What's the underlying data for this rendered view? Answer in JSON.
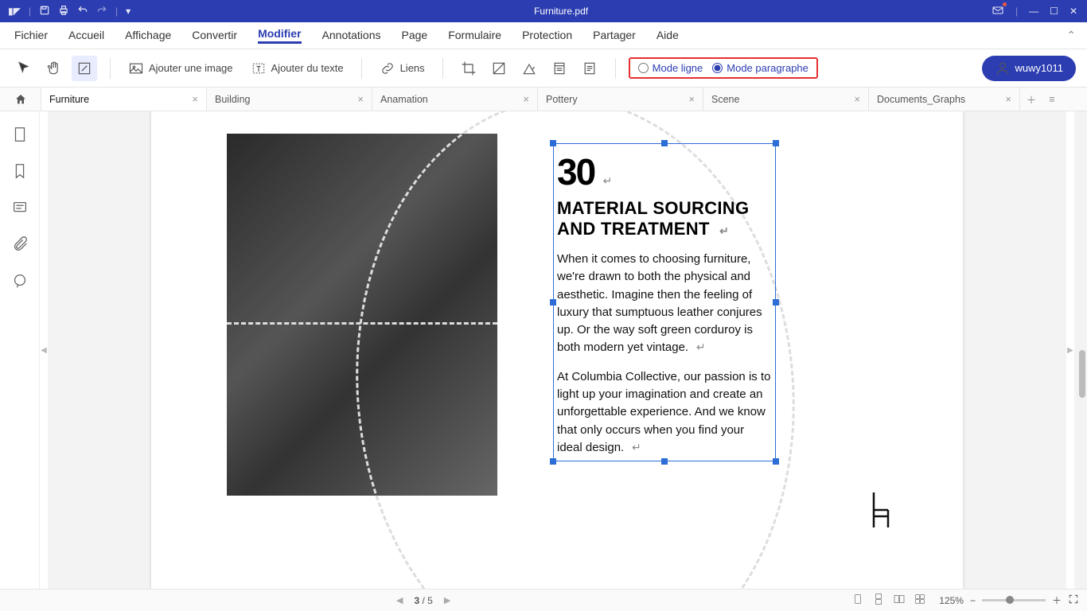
{
  "title": "Furniture.pdf",
  "menu": [
    "Fichier",
    "Accueil",
    "Affichage",
    "Convertir",
    "Modifier",
    "Annotations",
    "Page",
    "Formulaire",
    "Protection",
    "Partager",
    "Aide"
  ],
  "menu_active_index": 4,
  "toolbar": {
    "add_image": "Ajouter une image",
    "add_text": "Ajouter du texte",
    "links": "Liens",
    "mode_line": "Mode ligne",
    "mode_paragraph": "Mode paragraphe",
    "mode_selected": "paragraph"
  },
  "user": "wuwy1011",
  "tabs": [
    {
      "label": "Furniture",
      "active": true
    },
    {
      "label": "Building",
      "active": false
    },
    {
      "label": "Anamation",
      "active": false
    },
    {
      "label": "Pottery",
      "active": false
    },
    {
      "label": "Scene",
      "active": false
    },
    {
      "label": "Documents_Graphs",
      "active": false
    }
  ],
  "document": {
    "page_number": "30",
    "heading_l1": "MATERIAL SOURCING",
    "heading_l2": "AND TREATMENT",
    "para1": "When it comes to choosing furniture, we're drawn to both the physical and aesthetic. Imagine then the feeling of luxury that sumptuous leather conjures up. Or the way soft green corduroy is both modern yet vintage.",
    "para2": "At Columbia Collective, our passion is to light up your imagination and create an unforgettable experience. And we know that only occurs when you find your ideal design."
  },
  "status": {
    "page_current": "3",
    "page_sep": " / ",
    "page_total": "5",
    "zoom": "125%"
  }
}
